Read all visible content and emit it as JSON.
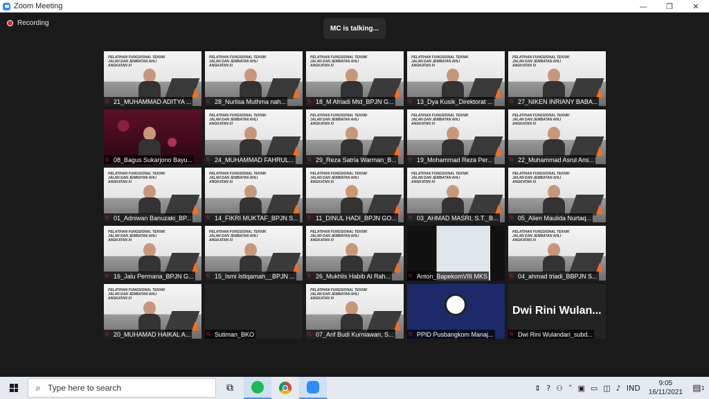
{
  "window": {
    "title": "Zoom Meeting",
    "minimize": "—",
    "maximize": "❐",
    "close": "✕"
  },
  "meeting": {
    "recording_label": "Recording",
    "talking": "MC is talking..."
  },
  "slide_text": "PELATIHAN FUNGSIONAL TEKNIK JALAN DAN JEMBATAN AHLI ANGKATAN XI",
  "participants": [
    {
      "name": "21_MUHAMMAD ADITYA ...",
      "tile": "slide"
    },
    {
      "name": "28_Nurlisa Muthma nah...",
      "tile": "slide"
    },
    {
      "name": "18_M Afriadi Mtd_BPJN G...",
      "tile": "slide"
    },
    {
      "name": "13_Dya Kusik_Direktorat ...",
      "tile": "slide"
    },
    {
      "name": "27_NIKEN INRIANY BABA...",
      "tile": "slide"
    },
    {
      "name": "08_Bagus Sukarjono Bayu...",
      "tile": "floral"
    },
    {
      "name": "24_MUHAMMAD FAHRUL...",
      "tile": "slide"
    },
    {
      "name": "29_Reza Satria Warman_B...",
      "tile": "slide"
    },
    {
      "name": "19_Mohammad Reza Per...",
      "tile": "slide"
    },
    {
      "name": "22_Muhammad Asrul Ans...",
      "tile": "slide"
    },
    {
      "name": "01_Adniwan Banuzaki_BP...",
      "tile": "slide"
    },
    {
      "name": "14_FIKRI MUKTAF_BPJN S...",
      "tile": "slide"
    },
    {
      "name": "11_DINUL HADI_BPJN GO...",
      "tile": "slide"
    },
    {
      "name": "03_AHMAD MASRI, S.T._B...",
      "tile": "slide"
    },
    {
      "name": "05_Alien Maulida Nurtaq...",
      "tile": "slide"
    },
    {
      "name": "16_Jalu Permana_BPJN G...",
      "tile": "slide"
    },
    {
      "name": "15_Ismi Istiqamah__BPJN ...",
      "tile": "slide"
    },
    {
      "name": "26_Mukhlis Habib Al Rah...",
      "tile": "slide"
    },
    {
      "name": "Anton_BapekomVIII MKS",
      "tile": "dark-ppt"
    },
    {
      "name": "04_ahmad triadi_BBPJN S...",
      "tile": "slide"
    },
    {
      "name": "20_MUHAMAD HAIKAL A...",
      "tile": "slide"
    },
    {
      "name": "Sutiman_BKO",
      "tile": "blank"
    },
    {
      "name": "07_Arif Budi Kurniawan, S...",
      "tile": "slide"
    },
    {
      "name": "PPID Pusbangkom Manaj...",
      "tile": "obs"
    },
    {
      "name": "Dwi Rini Wulandari_subd...",
      "tile": "name",
      "big": "Dwi Rini Wulan..."
    }
  ],
  "taskbar": {
    "search_placeholder": "Type here to search",
    "language": "IND",
    "time": "9:05",
    "date": "16/11/2021",
    "notification_count": "1"
  }
}
